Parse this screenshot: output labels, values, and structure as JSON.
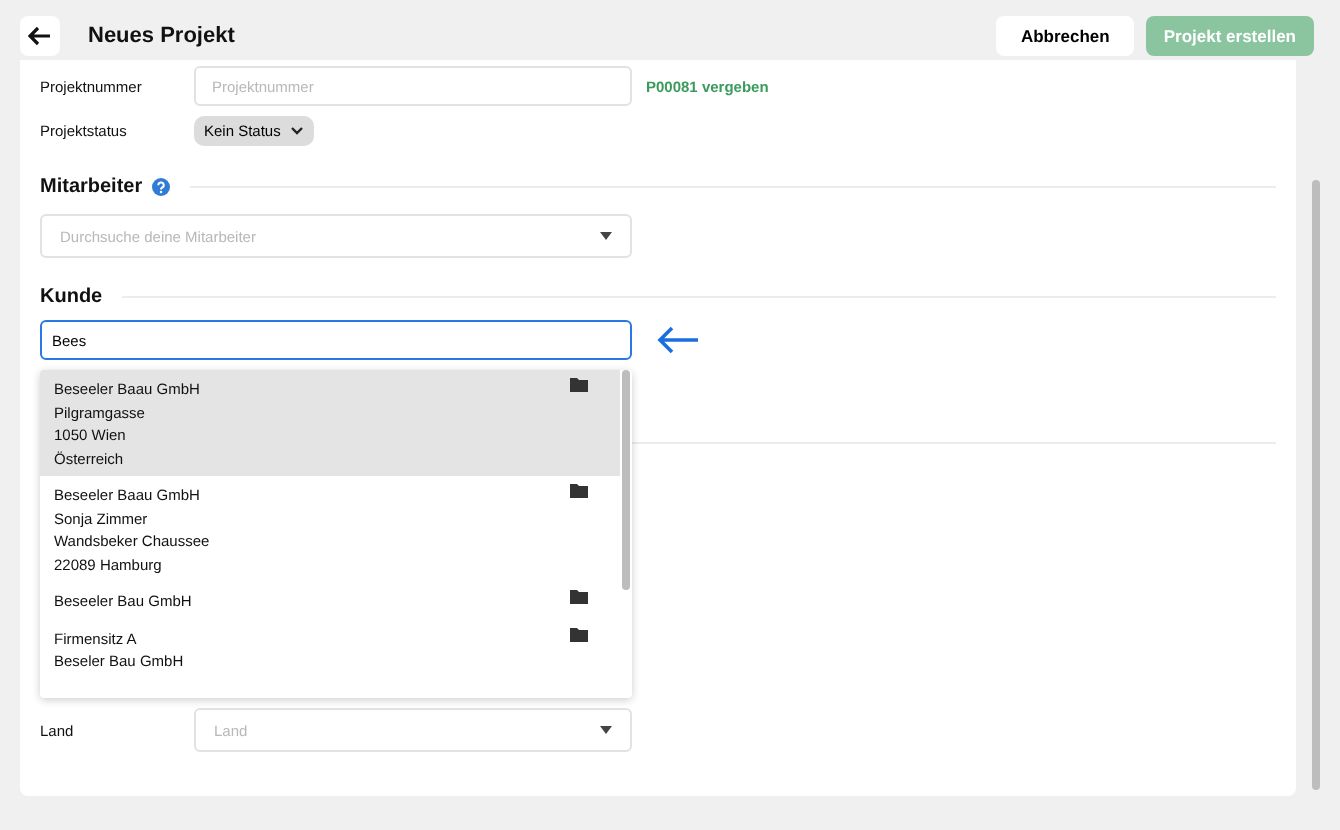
{
  "header": {
    "title": "Neues Projekt",
    "cancel_button": "Abbrechen",
    "create_button": "Projekt erstellen"
  },
  "project_number": {
    "label": "Projektnummer",
    "placeholder": "Projektnummer",
    "status": "P00081 vergeben"
  },
  "project_status": {
    "label": "Projektstatus",
    "value": "Kein Status"
  },
  "employees": {
    "heading": "Mitarbeiter",
    "placeholder": "Durchsuche deine Mitarbeiter"
  },
  "customer": {
    "heading": "Kunde",
    "value": "Bees",
    "results": [
      {
        "lines": [
          "Beseeler Baau GmbH",
          "Pilgramgasse",
          "1050 Wien",
          "Österreich"
        ],
        "selected": true
      },
      {
        "lines": [
          "Beseeler Baau GmbH",
          "Sonja Zimmer",
          "Wandsbeker Chaussee",
          "22089 Hamburg"
        ],
        "selected": false
      },
      {
        "lines": [
          "Beseeler Bau GmbH"
        ],
        "selected": false
      },
      {
        "lines": [
          "Firmensitz A",
          "Beseler Bau GmbH"
        ],
        "selected": false
      }
    ]
  },
  "country": {
    "label": "Land",
    "placeholder": "Land"
  }
}
